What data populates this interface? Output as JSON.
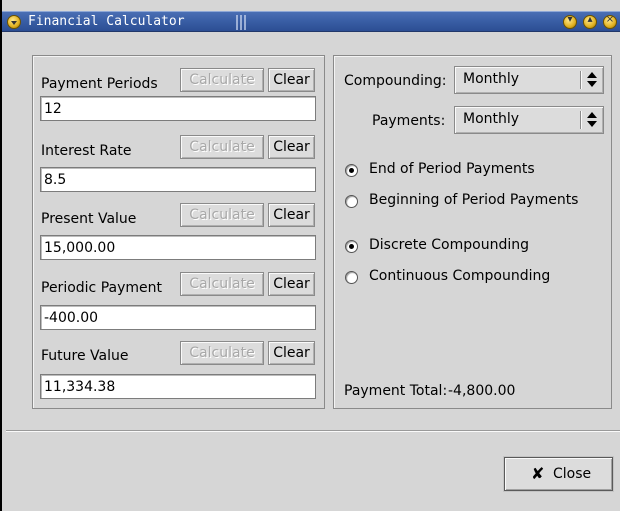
{
  "window": {
    "title": "Financial Calculator",
    "menu_icon": "window-menu-icon",
    "controls": [
      "minimize-icon",
      "maximize-icon",
      "close-icon"
    ]
  },
  "left_panel": {
    "calculate_label": "Calculate",
    "clear_label": "Clear",
    "fields": [
      {
        "label": "Payment Periods",
        "value": "12"
      },
      {
        "label": "Interest Rate",
        "value": "8.5"
      },
      {
        "label": "Present Value",
        "value": "15,000.00"
      },
      {
        "label": "Periodic Payment",
        "value": "-400.00"
      },
      {
        "label": "Future Value",
        "value": "11,334.38"
      }
    ]
  },
  "right_panel": {
    "compounding_label": "Compounding:",
    "compounding_value": "Monthly",
    "payments_label": "Payments:",
    "payments_value": "Monthly",
    "timing_options": [
      {
        "label": "End of Period Payments",
        "selected": true
      },
      {
        "label": "Beginning of Period Payments",
        "selected": false
      }
    ],
    "compounding_options": [
      {
        "label": "Discrete Compounding",
        "selected": true
      },
      {
        "label": "Continuous Compounding",
        "selected": false
      }
    ],
    "payment_total_label": "Payment Total:",
    "payment_total_value": "-4,800.00"
  },
  "footer": {
    "close_label": "Close",
    "close_icon": "x-icon"
  }
}
